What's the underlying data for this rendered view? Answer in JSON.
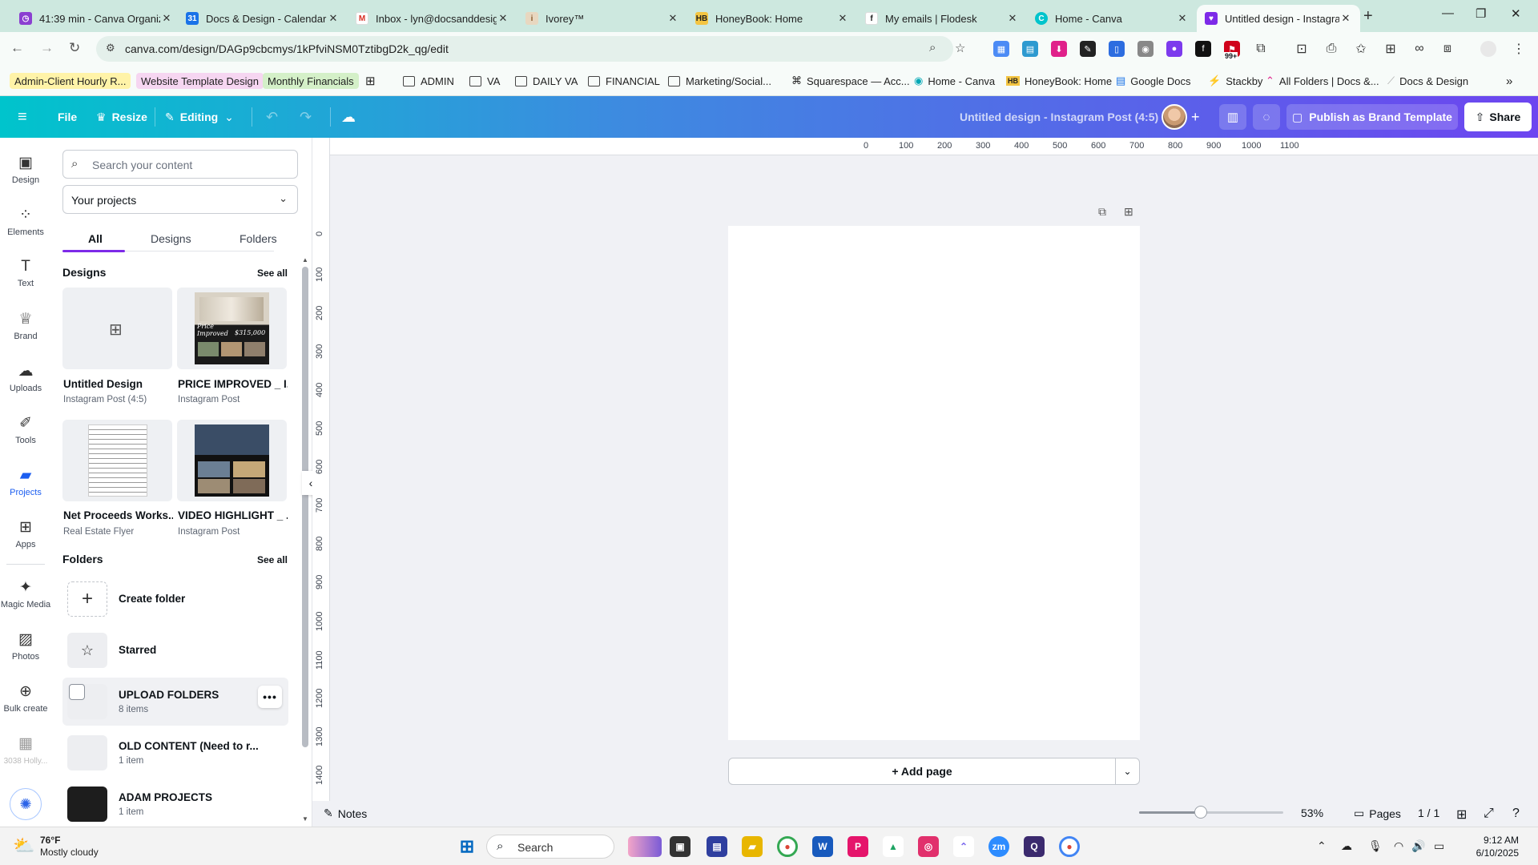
{
  "browser": {
    "tabs": [
      {
        "title": "41:39 min - Canva Organiz",
        "icon": "timer-icon",
        "color": "#8b3fd1"
      },
      {
        "title": "Docs & Design - Calendar",
        "icon": "calendar-icon",
        "color": "#1a73e8"
      },
      {
        "title": "Inbox - lyn@docsanddesig",
        "icon": "gmail-icon",
        "color": "#d93025"
      },
      {
        "title": "Ivorey™",
        "icon": "ivorey-icon",
        "color": "#b98b5a"
      },
      {
        "title": "HoneyBook: Home",
        "icon": "honeybook-icon",
        "color": "#1f1f1f"
      },
      {
        "title": "My emails | Flodesk",
        "icon": "flodesk-icon",
        "color": "#1f1f1f"
      },
      {
        "title": "Home - Canva",
        "icon": "canva-icon",
        "color": "#00c4cc"
      },
      {
        "title": "Untitled design - Instagram",
        "icon": "canva-heart-icon",
        "color": "#7d2ae8"
      }
    ],
    "url": "canva.com/design/DAGp9cbcmys/1kPfviNSM0TztibgD2k_qg/edit",
    "bookmarks": [
      "Admin-Client Hourly R...",
      "Website Template Design",
      "Monthly Financials",
      "ADMIN",
      "VA",
      "DAILY VA",
      "FINANCIAL",
      "Marketing/Social...",
      "Squarespace — Acc...",
      "Home - Canva",
      "HoneyBook: Home",
      "Google Docs",
      "Stackby",
      "All Folders | Docs &...",
      "Docs & Design"
    ],
    "ext_badge": "99+"
  },
  "topbar": {
    "file": "File",
    "resize": "Resize",
    "editing": "Editing",
    "doc_title": "Untitled design - Instagram Post (4:5)",
    "publish": "Publish as Brand Template",
    "share": "Share"
  },
  "rail": [
    {
      "label": "Design",
      "icon": "design-icon"
    },
    {
      "label": "Elements",
      "icon": "elements-icon"
    },
    {
      "label": "Text",
      "icon": "text-icon"
    },
    {
      "label": "Brand",
      "icon": "brand-icon"
    },
    {
      "label": "Uploads",
      "icon": "uploads-icon"
    },
    {
      "label": "Tools",
      "icon": "tools-icon"
    },
    {
      "label": "Projects",
      "icon": "projects-icon"
    },
    {
      "label": "Apps",
      "icon": "apps-icon"
    },
    {
      "label": "Magic Media",
      "icon": "magic-media-icon"
    },
    {
      "label": "Photos",
      "icon": "photos-icon"
    },
    {
      "label": "Bulk create",
      "icon": "bulk-create-icon"
    },
    {
      "label": "3038 Holly...",
      "icon": "folder-thumb-icon"
    }
  ],
  "panel": {
    "search_placeholder": "Search your content",
    "select_value": "Your projects",
    "tabs": [
      "All",
      "Designs",
      "Folders"
    ],
    "designs_heading": "Designs",
    "see_all": "See all",
    "designs": [
      {
        "name": "Untitled Design",
        "type": "Instagram Post (4:5)"
      },
      {
        "name": "PRICE IMPROVED _ I...",
        "type": "Instagram Post"
      },
      {
        "name": "Net Proceeds Works...",
        "type": "Real Estate Flyer"
      },
      {
        "name": "VIDEO HIGHLIGHT _ ...",
        "type": "Instagram Post"
      }
    ],
    "thumb_text": {
      "price_line1": "Price",
      "price_line2": "Improved",
      "price_value": "$315,000"
    },
    "folders_heading": "Folders",
    "folders": [
      {
        "name": "Create folder",
        "count": ""
      },
      {
        "name": "Starred",
        "count": ""
      },
      {
        "name": "UPLOAD FOLDERS",
        "count": "8 items"
      },
      {
        "name": "OLD CONTENT (Need to r...",
        "count": "1 item"
      },
      {
        "name": "ADAM PROJECTS",
        "count": "1 item"
      }
    ]
  },
  "ruler": {
    "h": [
      "0",
      "100",
      "200",
      "300",
      "400",
      "500",
      "600",
      "700",
      "800",
      "900",
      "1000",
      "1100"
    ],
    "v": [
      "0",
      "100",
      "200",
      "300",
      "400",
      "500",
      "600",
      "700",
      "800",
      "900",
      "1000",
      "1100",
      "1200",
      "1300",
      "1400"
    ]
  },
  "canvas": {
    "add_page": "+ Add page"
  },
  "bottom": {
    "notes": "Notes",
    "zoom": "53%",
    "zoom_level": 0.43,
    "pages": "Pages",
    "page_count": "1 / 1"
  },
  "taskbar": {
    "temp": "76°F",
    "weather": "Mostly cloudy",
    "search": "Search",
    "time": "9:12 AM",
    "date": "6/10/2025"
  }
}
